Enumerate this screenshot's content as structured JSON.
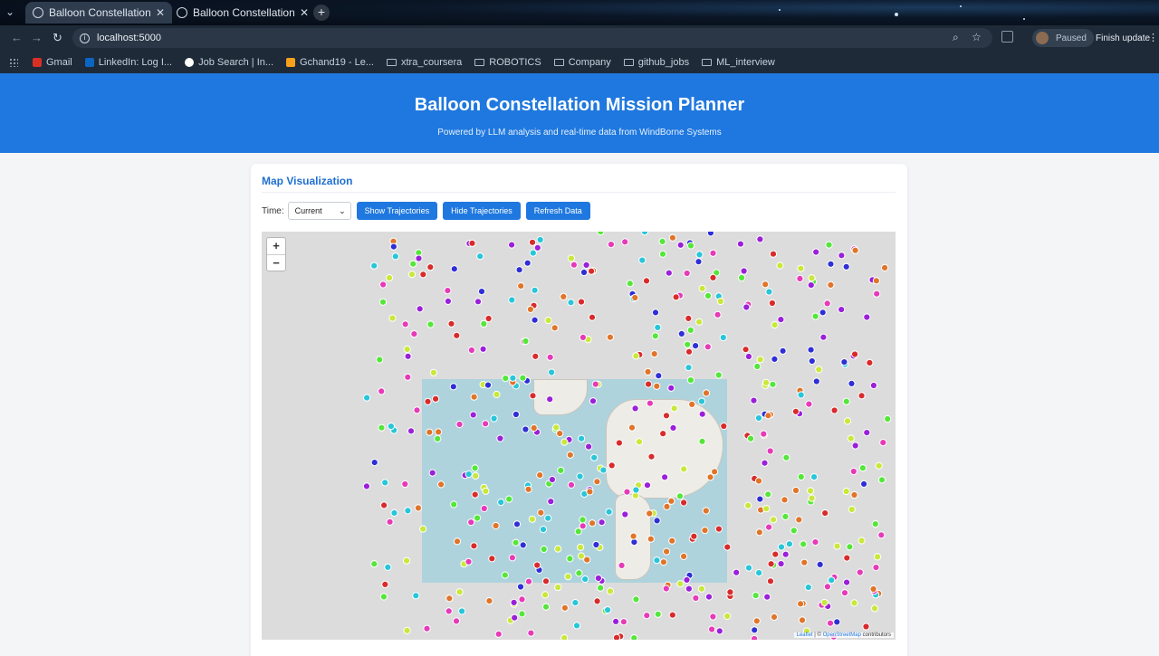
{
  "browser": {
    "tabs": [
      {
        "title": "Balloon Constellation M",
        "active": true
      },
      {
        "title": "Balloon Constellation M",
        "active": false
      }
    ],
    "address": "localhost:5000",
    "profile_status": "Paused",
    "update_label": "Finish update",
    "bookmarks": [
      {
        "label": "Gmail",
        "icon": "gmail-icon",
        "color": "#d93025"
      },
      {
        "label": "LinkedIn: Log I...",
        "icon": "linkedin-icon",
        "color": "#0a66c2"
      },
      {
        "label": "Job Search | In...",
        "icon": "info-icon",
        "color": "#ffffff"
      },
      {
        "label": "Gchand19 - Le...",
        "icon": "leetcode-icon",
        "color": "#f7a01c"
      },
      {
        "label": "xtra_coursera",
        "icon": "folder-icon"
      },
      {
        "label": "ROBOTICS",
        "icon": "folder-icon"
      },
      {
        "label": "Company",
        "icon": "folder-icon"
      },
      {
        "label": "github_jobs",
        "icon": "folder-icon"
      },
      {
        "label": "ML_interview",
        "icon": "folder-icon"
      }
    ]
  },
  "header": {
    "title": "Balloon Constellation Mission Planner",
    "subtitle": "Powered by LLM analysis and real-time data from WindBorne Systems",
    "color": "#1f78df"
  },
  "map_section": {
    "title": "Map Visualization",
    "time_label": "Time:",
    "time_value": "Current",
    "buttons": {
      "show": "Show Trajectories",
      "hide": "Hide Trajectories",
      "refresh": "Refresh Data"
    },
    "zoom_in": "+",
    "zoom_out": "−",
    "attribution_leaflet": "Leaflet",
    "attribution_sep": " | © ",
    "attribution_osm": "OpenStreetMap",
    "attribution_tail": " contributors",
    "marker_colors": [
      "#d92b2b",
      "#9b20d9",
      "#2f2fd6",
      "#27c6d9",
      "#55e63a",
      "#c8e83a",
      "#e0752a",
      "#e63ab8"
    ]
  }
}
